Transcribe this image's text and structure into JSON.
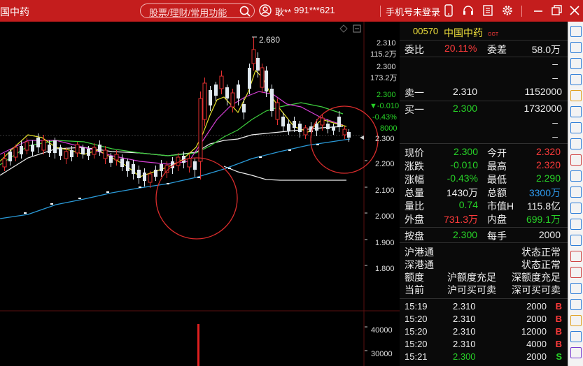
{
  "topbar": {
    "stock_short": "国中药",
    "search_placeholder": "股票/理财/常用功能",
    "user_name": "耿**",
    "user_id": "991***621",
    "phone_login": "手机号未登录",
    "bg_color": "#c41d1d"
  },
  "chart": {
    "high_marker": "2.680",
    "price_labels": [
      "2.310",
      "2.300",
      "2.200",
      "2.100",
      "2.000",
      "1.900",
      "1.800"
    ],
    "volume_labels": [
      "40000",
      "30000"
    ],
    "tag_price1": "2.310",
    "tag_vol1": "115.2万",
    "tag_price2": "2.300",
    "tag_vol2": "173.2万",
    "tag_last": "2.300",
    "tag_change": "▼-0.010",
    "tag_pct": "-0.43%",
    "tag_vol": "8000",
    "tag_ref": "2.300"
  },
  "quote": {
    "code": "00570",
    "name": "中国中药",
    "ggt": "GGT",
    "weibi_label": "委比",
    "weibi_value": "20.11%",
    "weicha_label": "委差",
    "weicha_value": "58.0万",
    "dash": "–",
    "ask1_label": "卖一",
    "ask1_price": "2.310",
    "ask1_vol": "1152000",
    "bid1_label": "买一",
    "bid1_price": "2.300",
    "bid1_vol": "1732000",
    "stats": [
      {
        "l1": "现价",
        "v1": "2.300",
        "c1": "green",
        "l2": "今开",
        "v2": "2.320",
        "c2": "red"
      },
      {
        "l1": "涨跌",
        "v1": "-0.010",
        "c1": "green",
        "l2": "最高",
        "v2": "2.320",
        "c2": "red"
      },
      {
        "l1": "涨幅",
        "v1": "-0.43%",
        "c1": "green",
        "l2": "最低",
        "v2": "2.290",
        "c2": "green"
      },
      {
        "l1": "总量",
        "v1": "1430万",
        "c1": "white",
        "l2": "总额",
        "v2": "3300万",
        "c2": "blue"
      },
      {
        "l1": "量比",
        "v1": "0.74",
        "c1": "green",
        "l2": "市值H",
        "v2": "115.8亿",
        "c2": "white"
      },
      {
        "l1": "外盘",
        "v1": "731.3万",
        "c1": "red",
        "l2": "内盘",
        "v2": "699.1万",
        "c2": "green"
      }
    ],
    "lot_label": "按盘",
    "lot_price": "2.300",
    "per_hand_label": "每手",
    "per_hand_value": "2000",
    "connect": [
      {
        "l": "沪港通",
        "r": "状态正常"
      },
      {
        "l": "深港通",
        "r": "状态正常"
      },
      {
        "l": "额度",
        "m": "沪额度充足",
        "r": "深额度充足"
      },
      {
        "l": "当前",
        "m": "沪可买可卖",
        "r": "深可买可卖"
      }
    ],
    "ticks": [
      {
        "time": "15:19",
        "price": "2.310",
        "vol": "2000",
        "side": "B",
        "pc": "white",
        "sc": "red"
      },
      {
        "time": "15:20",
        "price": "2.310",
        "vol": "2000",
        "side": "B",
        "pc": "white",
        "sc": "red"
      },
      {
        "time": "15:20",
        "price": "2.310",
        "vol": "12000",
        "side": "B",
        "pc": "white",
        "sc": "red"
      },
      {
        "time": "15:20",
        "price": "2.310",
        "vol": "4000",
        "side": "B",
        "pc": "white",
        "sc": "red"
      },
      {
        "time": "15:21",
        "price": "2.300",
        "vol": "2000",
        "side": "S",
        "pc": "green",
        "sc": "green"
      }
    ]
  },
  "toolbar_icons": [
    "collapse-icon",
    "vol-icon",
    "export-icon",
    "up-icon",
    "grid-icon",
    "list-icon",
    "ask-icon",
    "chart-icon",
    "tools-icon",
    "finance-icon",
    "f10-icon",
    "ladder-icon",
    "f12-icon",
    "bar-icon",
    "sq-icon",
    "wave-icon",
    "rsi-icon",
    "move-icon",
    "draw-icon",
    "f5-icon",
    "ai-icon"
  ]
}
